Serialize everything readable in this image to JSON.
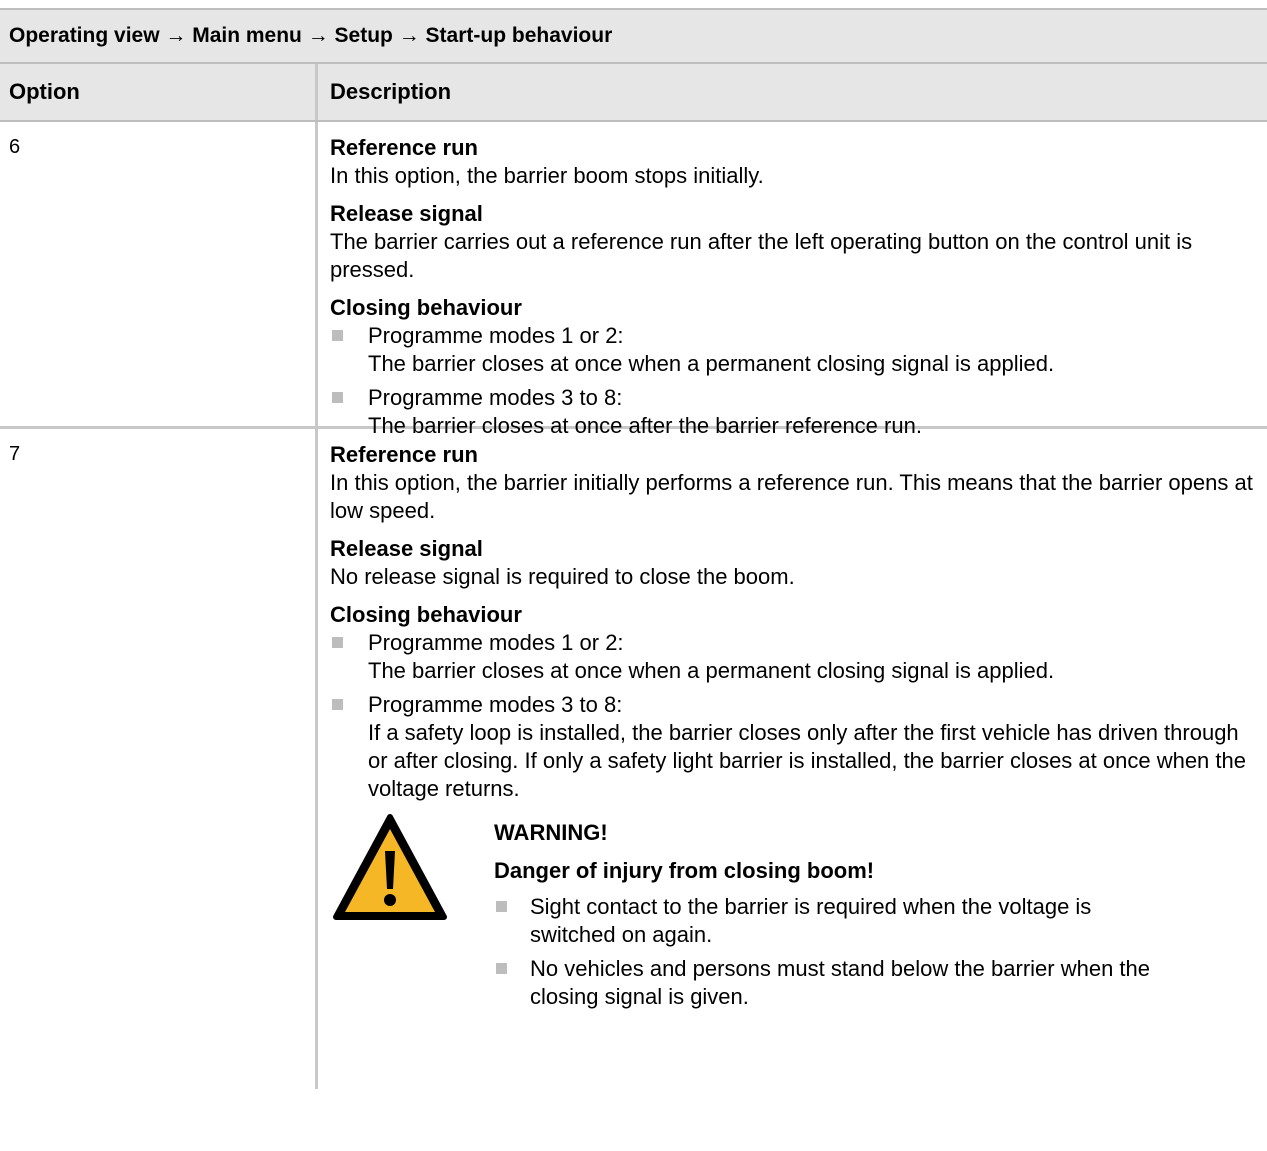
{
  "breadcrumb": "Operating view → Main menu → Setup → Start-up behaviour",
  "table": {
    "headers": [
      "Option",
      "Description"
    ],
    "rows": [
      {
        "option": "6",
        "reference_heading": "Reference run",
        "reference_text": "In this option, the barrier boom stops initially.",
        "release_heading": "Release signal",
        "release_text": "The barrier carries out a reference run after the left operating button on the control unit is pressed.",
        "closing_heading": "Closing behaviour",
        "closing_items": [
          {
            "title": "Programme modes 1 or 2:",
            "text": "The barrier closes at once when a permanent closing signal is applied."
          },
          {
            "title": "Programme modes 3 to 8:",
            "text": "The barrier closes at once after the barrier reference run."
          }
        ]
      },
      {
        "option": "7",
        "reference_heading": "Reference run",
        "reference_text": "In this option, the barrier initially performs a reference run. This means that the barrier opens at low speed.",
        "release_heading": "Release signal",
        "release_text": "No release signal is required to close the boom.",
        "closing_heading": "Closing behaviour",
        "closing_items": [
          {
            "title": "Programme modes 1 or 2:",
            "text": "The barrier closes at once when a permanent closing signal is applied."
          },
          {
            "title": "Programme modes 3 to 8:",
            "text": "If a safety loop is installed, the barrier closes only after the first vehicle has driven through or after closing. If only a safety light barrier is installed, the barrier closes at once when the voltage returns."
          }
        ],
        "warning": {
          "icon": "warning-triangle-icon",
          "title": "WARNING!",
          "subtitle": "Danger of injury from closing boom!",
          "items": [
            "Sight contact to the barrier is required when the voltage is switched on again.",
            "No vehicles and persons must stand below the barrier when the closing signal is given."
          ]
        }
      }
    ]
  },
  "colors": {
    "header_bg": "#e6e6e6",
    "border": "#c8c8c8",
    "bullet": "#bdbdbd",
    "warning_fill": "#f6b727"
  }
}
